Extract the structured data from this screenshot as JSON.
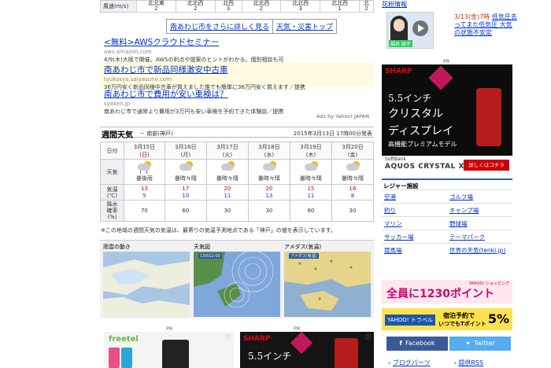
{
  "wind_table": {
    "row_label": "風速(m/s)",
    "cells": [
      "北北東\n2",
      "北北西\n2",
      "北西\n3",
      "北北西\n2",
      "北北西\n3",
      "北北西\n1",
      "北\n2"
    ]
  },
  "more_links": {
    "detail": "南あわじ市をさらに詳しく見る",
    "top": "天気・災害トップ"
  },
  "ads": [
    {
      "title": "<無料>AWSクラウドセミナー",
      "url": "aws.amazon.com",
      "desc": "4/9(木)大阪で開催。AWSの利点や提案のヒントがわかる。個別相談も可"
    },
    {
      "title": "南あわじ市で新品同様激安中古車",
      "url": "tyukosya.saiyasune.com",
      "desc": "36万円安く新品同様中古車が買えました誰でも簡単に36万円安く買えます／提携"
    },
    {
      "title": "南あわじ市で費用が安い車検は？",
      "url": "syaken.jp",
      "desc": "南あわじ市で通常より費用が3万円も安い車検を予約できた体験談／提携"
    }
  ],
  "ads_by": "Ads by Yahoo! JAPAN",
  "weekly": {
    "title": "週間天気",
    "area": "－ 南部(神戸)",
    "issued": "2015年3月13日 17時00分発表",
    "row_labels": {
      "date": "日付",
      "weather": "天気",
      "temp": "気温\n(℃)",
      "rain": "降水\n確率\n(%)"
    },
    "days": [
      {
        "date": "3月15日",
        "dow": "(日)",
        "dowtype": "sun",
        "weather": "曇後雨",
        "icon": "cloud-rain",
        "hi": "13",
        "lo": "5",
        "rain": "70"
      },
      {
        "date": "3月16日",
        "dow": "(月)",
        "dowtype": "",
        "weather": "曇時々晴",
        "icon": "cloud-sun",
        "hi": "17",
        "lo": "10",
        "rain": "60"
      },
      {
        "date": "3月17日",
        "dow": "(火)",
        "dowtype": "",
        "weather": "曇時々晴",
        "icon": "cloud-sun",
        "hi": "20",
        "lo": "11",
        "rain": "30"
      },
      {
        "date": "3月18日",
        "dow": "(水)",
        "dowtype": "",
        "weather": "曇時々晴",
        "icon": "cloud-sun",
        "hi": "20",
        "lo": "13",
        "rain": "30"
      },
      {
        "date": "3月19日",
        "dow": "(木)",
        "dowtype": "",
        "weather": "曇時々晴",
        "icon": "cloud-sun",
        "hi": "15",
        "lo": "11",
        "rain": "60"
      },
      {
        "date": "3月20日",
        "dow": "(金)",
        "dowtype": "",
        "weather": "曇時々晴",
        "icon": "cloud-sun",
        "hi": "16",
        "lo": "8",
        "rain": "30"
      }
    ],
    "note": "※この地域の週間天気の気温は、最寄りの気温予測地点である「神戸」の値を表示しています。"
  },
  "maps": [
    {
      "label": "雨雲の動き",
      "sub": ""
    },
    {
      "label": "天気図",
      "sub": "13日12:00"
    },
    {
      "label": "アメダス(気温)",
      "sub": "アメダス(気温)"
    }
  ],
  "pr_label": "PR",
  "ad_sharp_mid": {
    "brand": "SHARP",
    "text": "5.5インチ"
  },
  "ad_freetel": {
    "brand": "freetel"
  },
  "right": {
    "top_link": "花粉情報",
    "news_date": "3/13(金)7時",
    "news_text": "低気圧去ってまた低気圧 大気の状態不安定",
    "news_person": "福井 麻子",
    "sharp_ad": {
      "brand": "SHARP",
      "line1": "5.5インチ",
      "line2": "クリスタル",
      "line3": "ディスプレイ",
      "line4": "高機能プレミアムモデル",
      "carrier": "SoftBank",
      "model": "AQUOS CRYSTAL X",
      "cta": "詳しくはコチラ"
    },
    "leisure_title": "レジャー施設",
    "leisure": [
      "空港",
      "ゴルフ場",
      "釣り",
      "キャンプ場",
      "マリン",
      "野球場",
      "サッカー場",
      "テーマパーク",
      "競馬場",
      "世界の天気(tenki.jp)"
    ],
    "banner1": {
      "text": "全員に1230ポイント",
      "brand": "YAHOO! ショッピング"
    },
    "banner2": {
      "left": "YAHOO! トラベル",
      "line1": "宿泊予約で",
      "line2": "いつでもTポイント",
      "pct": "5%"
    },
    "facebook": "Facebook",
    "twitter": "Twitter",
    "blog": "ブログパーツ",
    "rss": "提供RSS"
  }
}
